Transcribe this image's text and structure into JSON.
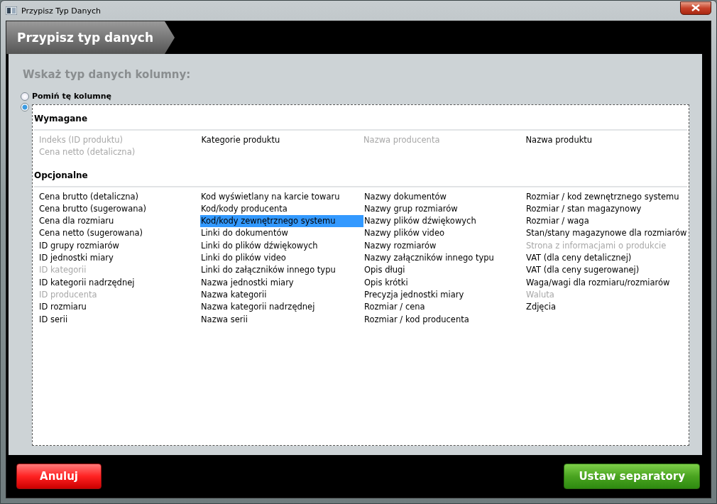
{
  "window": {
    "title": "Przypisz Typ Danych"
  },
  "header": {
    "title": "Przypisz typ danych"
  },
  "prompt": "Wskaż typ danych kolumny:",
  "options": [
    {
      "label": "Pomiń tę kolumnę",
      "selected": false
    },
    {
      "selected": true
    }
  ],
  "sections": [
    {
      "title": "Wymagane",
      "columns": [
        [
          {
            "label": "Indeks (ID produktu)",
            "disabled": true,
            "selected": false
          },
          {
            "label": "Cena netto (detaliczna)",
            "disabled": true,
            "selected": false
          }
        ],
        [
          {
            "label": "Kategorie produktu",
            "disabled": false,
            "selected": false
          }
        ],
        [
          {
            "label": "Nazwa producenta",
            "disabled": true,
            "selected": false
          }
        ],
        [
          {
            "label": "Nazwa produktu",
            "disabled": false,
            "selected": false
          }
        ]
      ]
    },
    {
      "title": "Opcjonalne",
      "columns": [
        [
          {
            "label": "Cena brutto (detaliczna)",
            "disabled": false,
            "selected": false
          },
          {
            "label": "Cena brutto (sugerowana)",
            "disabled": false,
            "selected": false
          },
          {
            "label": "Cena dla rozmiaru",
            "disabled": false,
            "selected": false
          },
          {
            "label": "Cena netto (sugerowana)",
            "disabled": false,
            "selected": false
          },
          {
            "label": "ID grupy rozmiarów",
            "disabled": false,
            "selected": false
          },
          {
            "label": "ID jednostki miary",
            "disabled": false,
            "selected": false
          },
          {
            "label": "ID kategorii",
            "disabled": true,
            "selected": false
          },
          {
            "label": "ID kategorii nadrzędnej",
            "disabled": false,
            "selected": false
          },
          {
            "label": "ID producenta",
            "disabled": true,
            "selected": false
          },
          {
            "label": "ID rozmiaru",
            "disabled": false,
            "selected": false
          },
          {
            "label": "ID serii",
            "disabled": false,
            "selected": false
          }
        ],
        [
          {
            "label": "Kod wyświetlany na karcie towaru",
            "disabled": false,
            "selected": false
          },
          {
            "label": "Kod/kody producenta",
            "disabled": false,
            "selected": false
          },
          {
            "label": "Kod/kody zewnętrznego systemu",
            "disabled": false,
            "selected": true
          },
          {
            "label": "Linki do dokumentów",
            "disabled": false,
            "selected": false
          },
          {
            "label": "Linki do plików dźwiękowych",
            "disabled": false,
            "selected": false
          },
          {
            "label": "Linki do plików video",
            "disabled": false,
            "selected": false
          },
          {
            "label": "Linki do załączników innego typu",
            "disabled": false,
            "selected": false
          },
          {
            "label": "Nazwa jednostki miary",
            "disabled": false,
            "selected": false
          },
          {
            "label": "Nazwa kategorii",
            "disabled": false,
            "selected": false
          },
          {
            "label": "Nazwa kategorii nadrzędnej",
            "disabled": false,
            "selected": false
          },
          {
            "label": "Nazwa serii",
            "disabled": false,
            "selected": false
          }
        ],
        [
          {
            "label": "Nazwy dokumentów",
            "disabled": false,
            "selected": false
          },
          {
            "label": "Nazwy grup rozmiarów",
            "disabled": false,
            "selected": false
          },
          {
            "label": "Nazwy plików dźwiękowych",
            "disabled": false,
            "selected": false
          },
          {
            "label": "Nazwy plików video",
            "disabled": false,
            "selected": false
          },
          {
            "label": "Nazwy rozmiarów",
            "disabled": false,
            "selected": false
          },
          {
            "label": "Nazwy załączników innego typu",
            "disabled": false,
            "selected": false
          },
          {
            "label": "Opis długi",
            "disabled": false,
            "selected": false
          },
          {
            "label": "Opis krótki",
            "disabled": false,
            "selected": false
          },
          {
            "label": "Precyzja jednostki miary",
            "disabled": false,
            "selected": false
          },
          {
            "label": "Rozmiar / cena",
            "disabled": false,
            "selected": false
          },
          {
            "label": "Rozmiar / kod producenta",
            "disabled": false,
            "selected": false
          }
        ],
        [
          {
            "label": "Rozmiar / kod zewnętrznego systemu",
            "disabled": false,
            "selected": false
          },
          {
            "label": "Rozmiar / stan magazynowy",
            "disabled": false,
            "selected": false
          },
          {
            "label": "Rozmiar / waga",
            "disabled": false,
            "selected": false
          },
          {
            "label": "Stan/stany magazynowe dla rozmiarów",
            "disabled": false,
            "selected": false
          },
          {
            "label": "Strona z informacjami o produkcie",
            "disabled": true,
            "selected": false
          },
          {
            "label": "VAT (dla ceny detalicznej)",
            "disabled": false,
            "selected": false
          },
          {
            "label": "VAT (dla ceny sugerowanej)",
            "disabled": false,
            "selected": false
          },
          {
            "label": "Waga/wagi dla rozmiaru/rozmiarów",
            "disabled": false,
            "selected": false
          },
          {
            "label": "Waluta",
            "disabled": true,
            "selected": false
          },
          {
            "label": "Zdjęcia",
            "disabled": false,
            "selected": false
          }
        ]
      ]
    }
  ],
  "buttons": [
    {
      "label": "Anuluj",
      "kind": "cancel"
    },
    {
      "label": "Ustaw separatory",
      "kind": "confirm"
    }
  ]
}
